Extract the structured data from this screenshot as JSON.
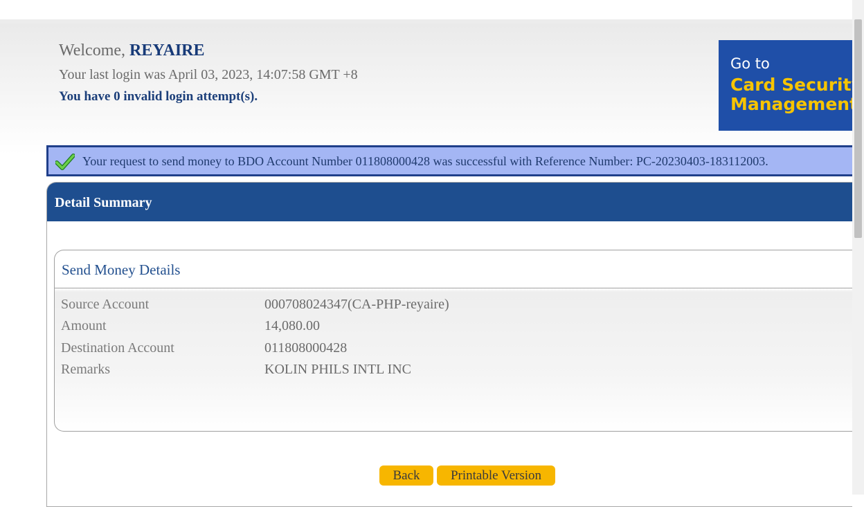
{
  "header": {
    "welcome_prefix": "Welcome, ",
    "username": "REYAIRE",
    "last_login": "Your last login was April 03, 2023, 14:07:58 GMT +8",
    "invalid_attempts": "You have 0 invalid login attempt(s)."
  },
  "banner": {
    "line1": "Go to",
    "line2": "Card Security",
    "line3": "Management",
    "bg_color": "#1f4fa8",
    "accent_color": "#f7c400"
  },
  "alert": {
    "icon": "checkmark-icon",
    "message": "Your request to send money to BDO Account Number 011808000428 was successful with Reference Number: PC-20230403-183112003."
  },
  "panel": {
    "title": "Detail Summary",
    "section_title": "Send Money Details",
    "rows": [
      {
        "label": "Source Account",
        "value": "000708024347(CA-PHP-reyaire)"
      },
      {
        "label": "Amount",
        "value": "14,080.00"
      },
      {
        "label": "Destination Account",
        "value": "011808000428"
      },
      {
        "label": "Remarks",
        "value": "KOLIN PHILS INTL INC"
      }
    ]
  },
  "actions": {
    "back_label": "Back",
    "print_label": "Printable Version",
    "button_color": "#f7b600"
  },
  "colors": {
    "header_blue": "#1e4e8f",
    "alert_bg": "#a4b6f4"
  }
}
